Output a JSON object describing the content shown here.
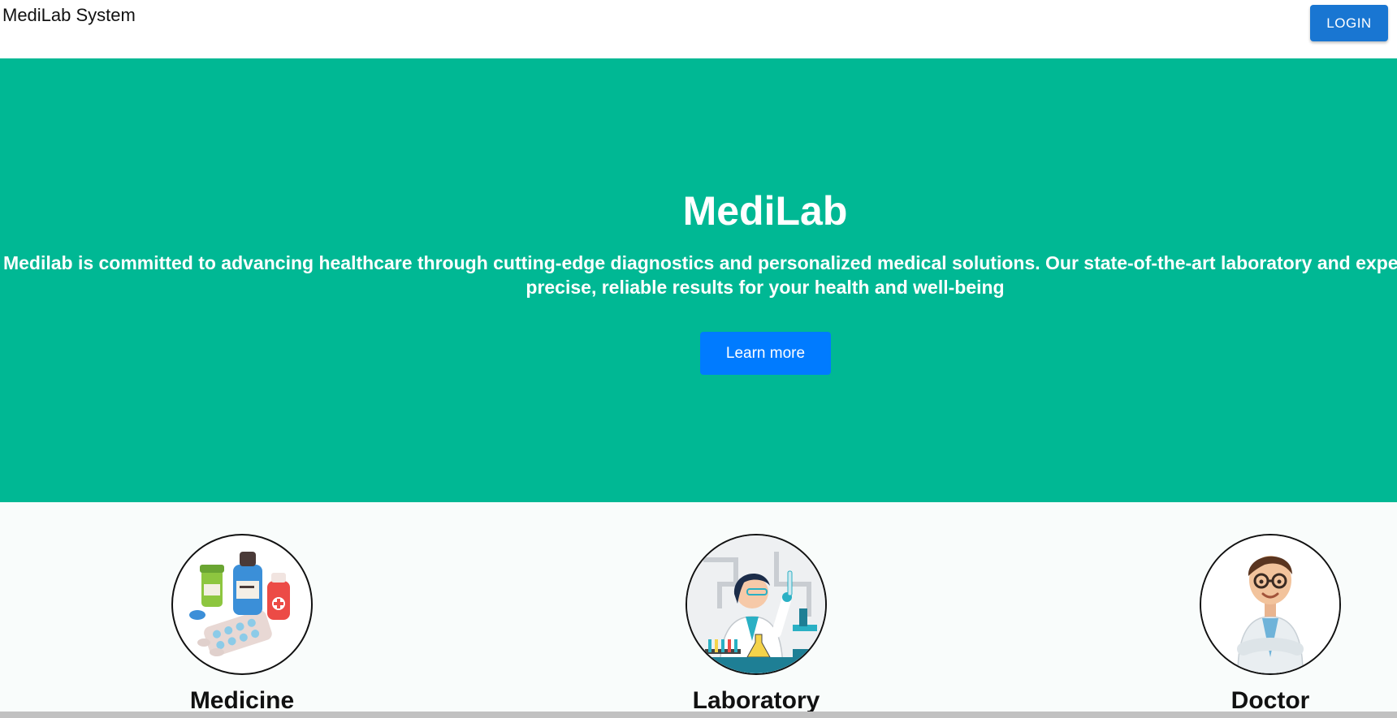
{
  "header": {
    "brand": "MediLab System",
    "login_label": "LOGIN"
  },
  "hero": {
    "title": "MediLab",
    "description": "Medilab is committed to advancing healthcare through cutting-edge diagnostics and personalized medical solutions. Our state-of-the-art laboratory and expert team ensure precise, reliable results for your health and well-being",
    "cta_label": "Learn more"
  },
  "services": [
    {
      "label": "Medicine",
      "icon": "medicine-bottles-icon"
    },
    {
      "label": "Laboratory",
      "icon": "lab-scientist-icon"
    },
    {
      "label": "Doctor",
      "icon": "doctor-avatar-icon"
    }
  ],
  "colors": {
    "hero_bg": "#00b894",
    "login_btn": "#1976d2",
    "cta_btn": "#007bff"
  }
}
